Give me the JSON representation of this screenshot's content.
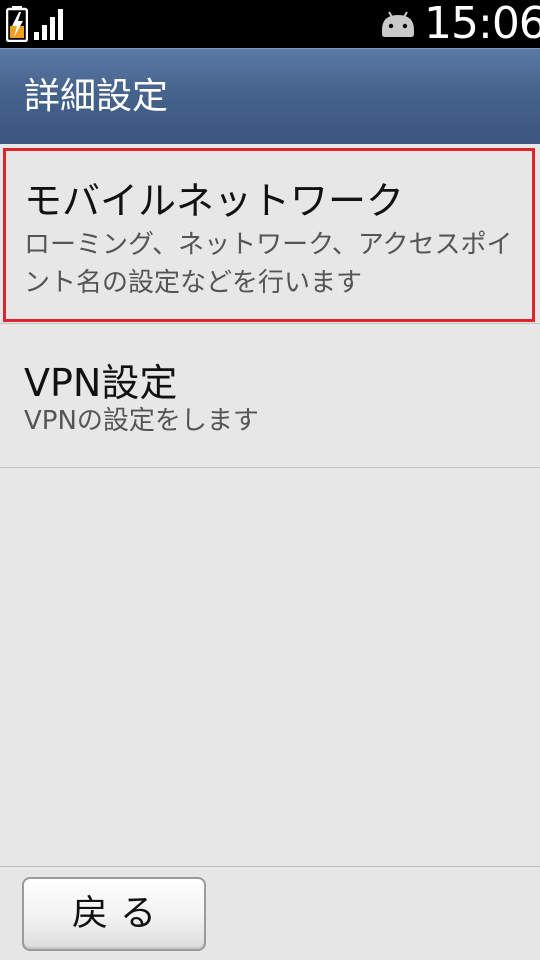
{
  "status_bar": {
    "time": "15:06",
    "icons": [
      "battery-charging-icon",
      "signal-strength-icon",
      "android-notification-icon"
    ]
  },
  "header": {
    "title": "詳細設定"
  },
  "list": {
    "items": [
      {
        "title": "モバイルネットワーク",
        "summary": "ローミング、ネットワーク、アクセスポイント名の設定などを行います",
        "highlighted": true
      },
      {
        "title": "VPN設定",
        "summary": "VPNの設定をします",
        "highlighted": false
      }
    ]
  },
  "footer": {
    "back_label": "戻る"
  },
  "colors": {
    "title_bar": "#46638c",
    "highlight_frame": "#e0242e",
    "battery_charge": "#f0a020",
    "android_icon": "#c9c9c9"
  }
}
